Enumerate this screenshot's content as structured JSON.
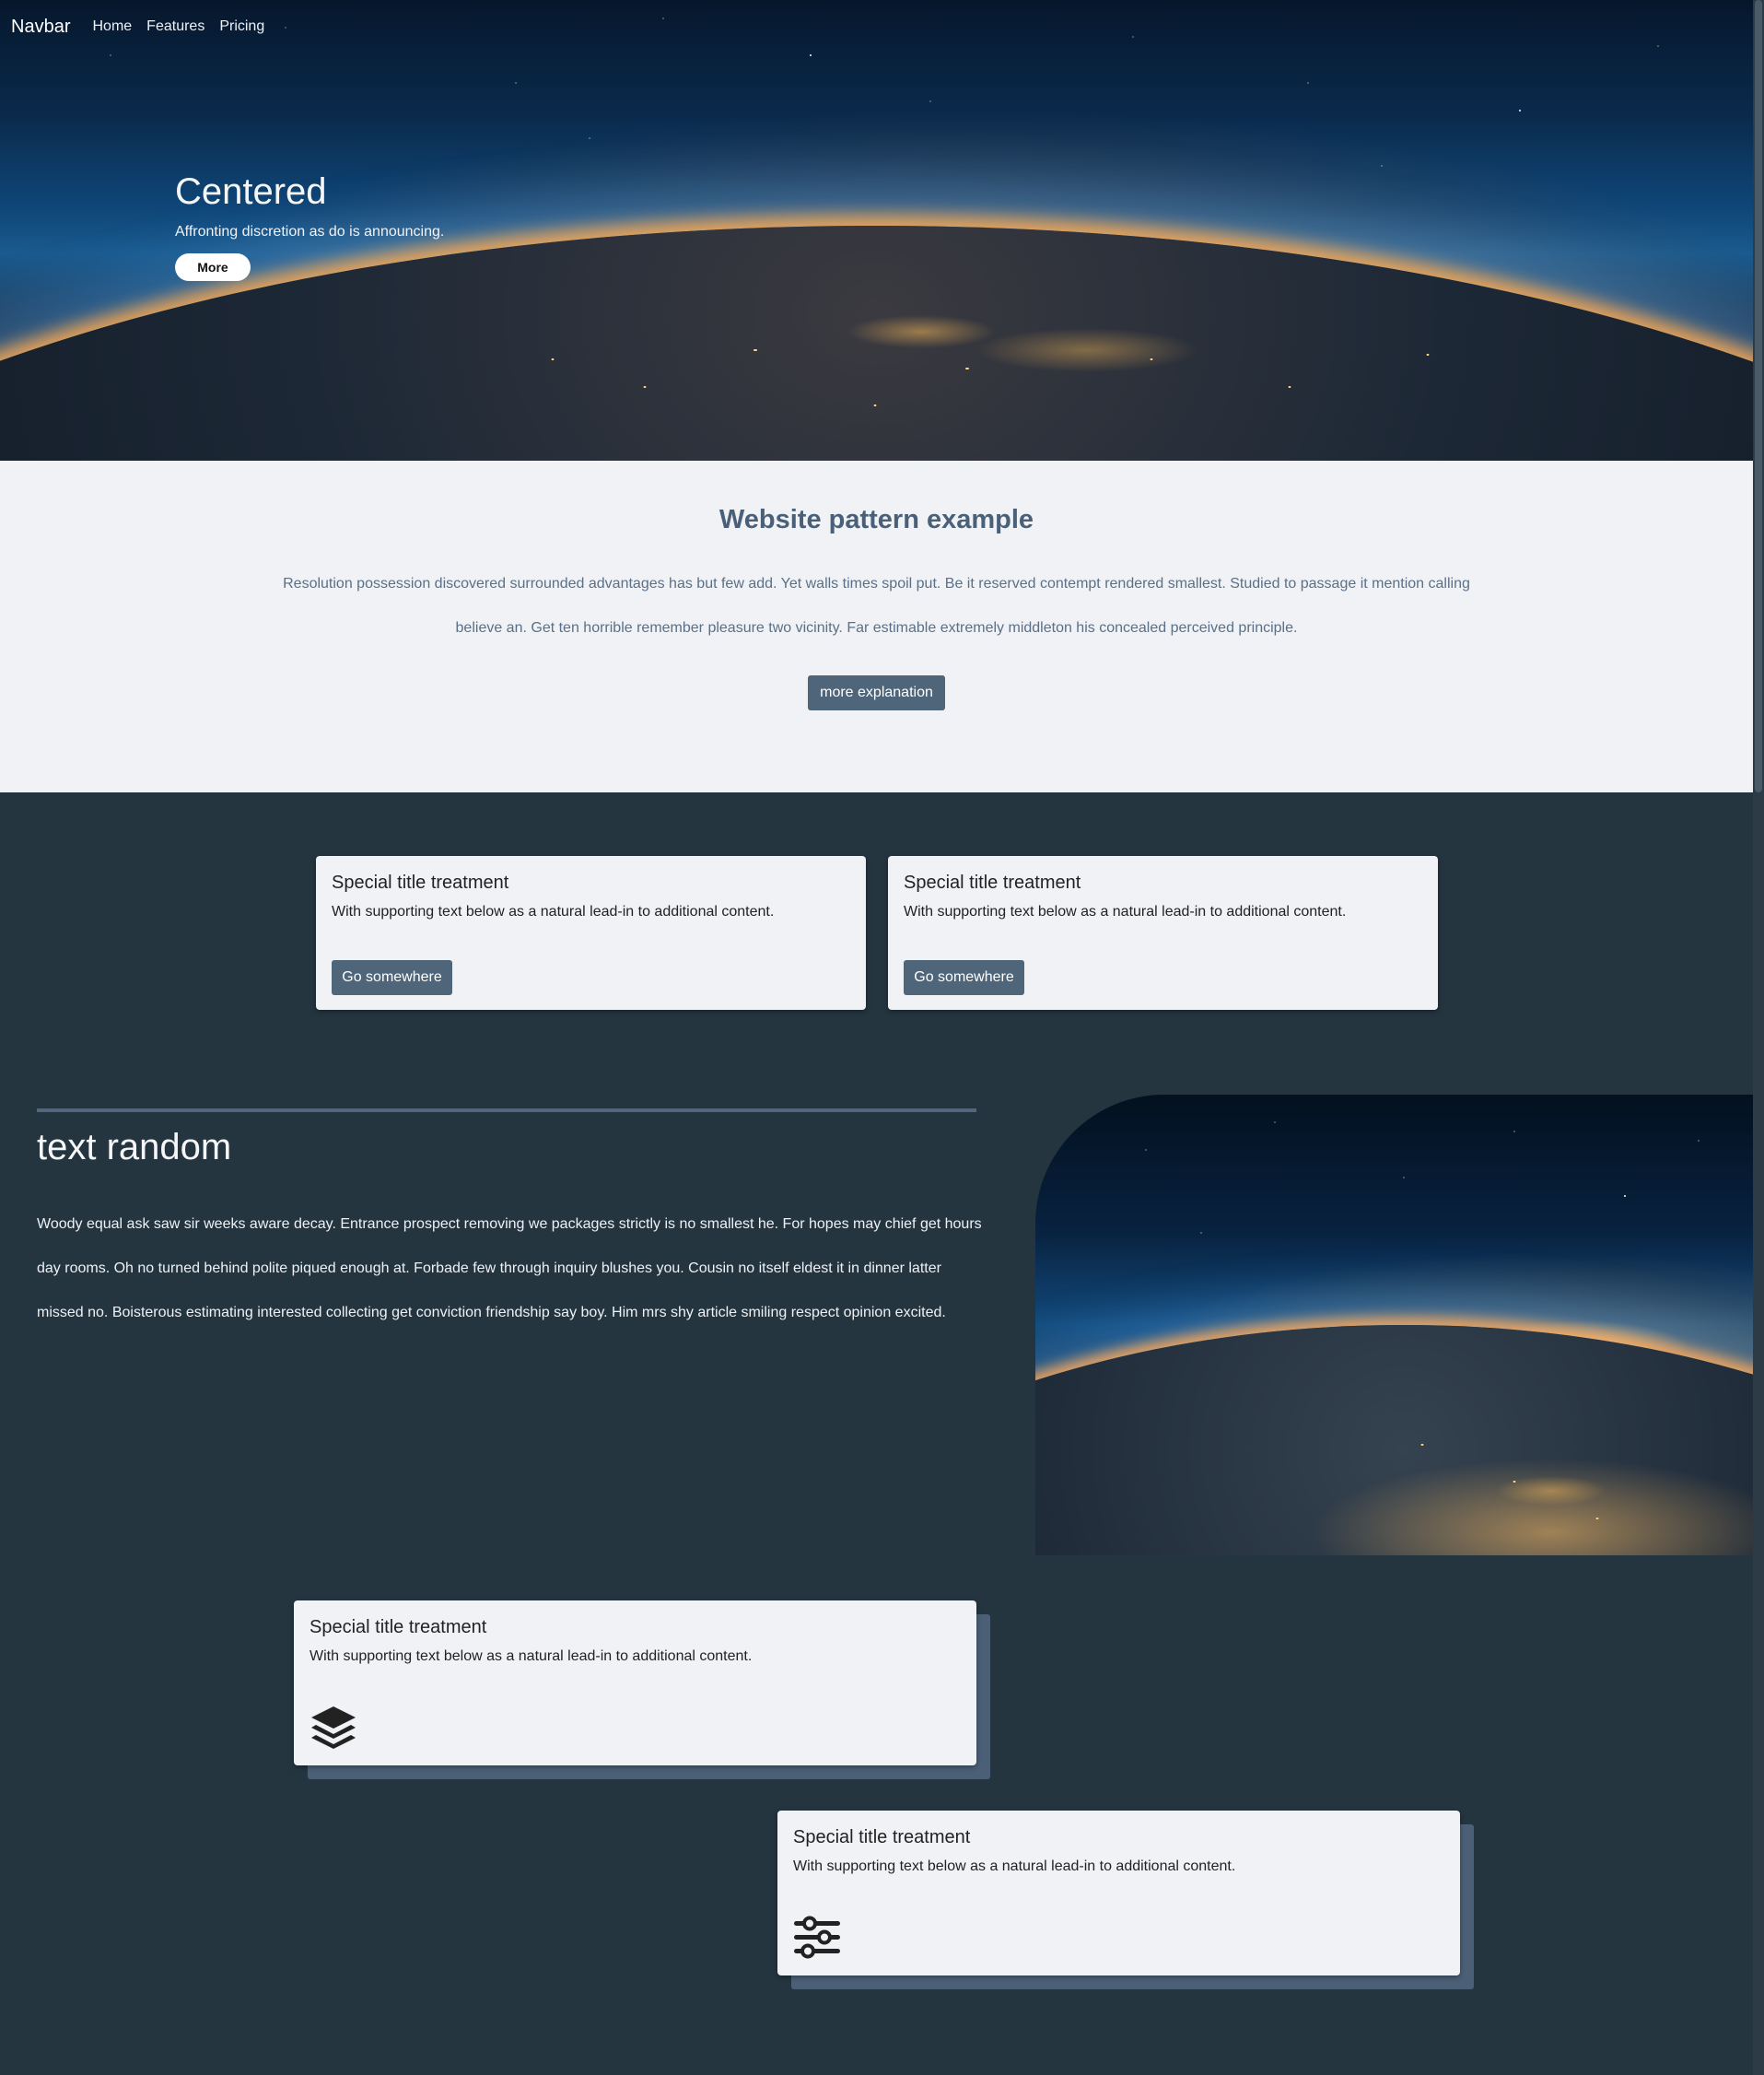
{
  "navbar": {
    "brand": "Navbar",
    "links": [
      "Home",
      "Features",
      "Pricing"
    ]
  },
  "hero": {
    "title": "Centered",
    "subtitle": "Affronting discretion as do is announcing.",
    "button": "More"
  },
  "pattern": {
    "title": "Website pattern example",
    "text": "Resolution possession discovered surrounded advantages has but few add. Yet walls times spoil put. Be it reserved contempt rendered smallest. Studied to passage it mention calling believe an. Get ten horrible remember pleasure two vicinity. Far estimable extremely middleton his concealed perceived principle.",
    "button": "more explanation"
  },
  "cards_row": [
    {
      "title": "Special title treatment",
      "text": "With supporting text below as a natural lead-in to additional content.",
      "button": "Go somewhere"
    },
    {
      "title": "Special title treatment",
      "text": "With supporting text below as a natural lead-in to additional content.",
      "button": "Go somewhere"
    }
  ],
  "text_random": {
    "title": "text random",
    "text": "Woody equal ask saw sir weeks aware decay. Entrance prospect removing we packages strictly is no smallest he. For hopes may chief get hours day rooms. Oh no turned behind polite piqued enough at. Forbade few through inquiry blushes you. Cousin no itself eldest it in dinner latter missed no. Boisterous estimating interested collecting get conviction friendship say boy. Him mrs shy article smiling respect opinion excited."
  },
  "feature_cards": [
    {
      "title": "Special title treatment",
      "text": "With supporting text below as a natural lead-in to additional content.",
      "icon": "layers-icon"
    },
    {
      "title": "Special title treatment",
      "text": "With supporting text below as a natural lead-in to additional content.",
      "icon": "sliders-icon"
    }
  ],
  "colors": {
    "page_bg": "#243540",
    "light_bg": "#f0f2f5",
    "accent": "#4e657a",
    "heading": "#4a6078"
  }
}
